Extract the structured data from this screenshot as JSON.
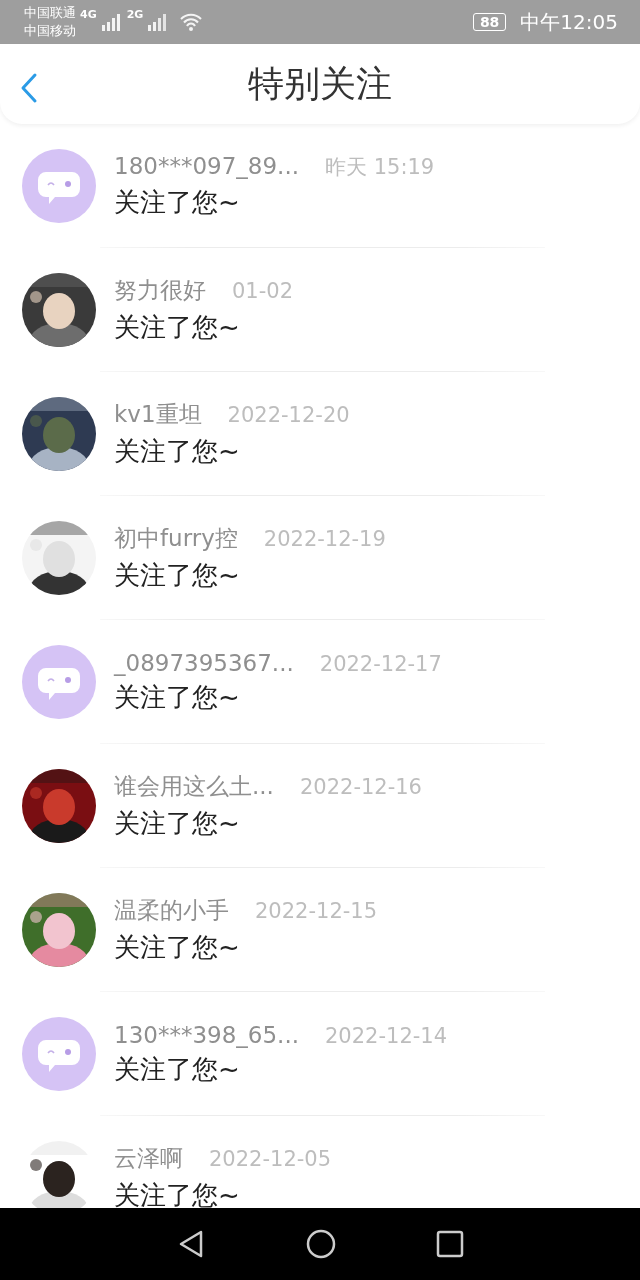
{
  "status_bar": {
    "carriers": [
      "中国联通",
      "中国移动"
    ],
    "network_1": "4G",
    "network_2": "2G",
    "battery": "88",
    "time": "中午12:05"
  },
  "header": {
    "title": "特别关注"
  },
  "notifications": [
    {
      "avatar": {
        "kind": "default"
      },
      "name": "180***097_89...",
      "time": "昨天 15:19",
      "message": "关注了您~"
    },
    {
      "name": "努力很好",
      "time": "01-02",
      "message": "关注了您~"
    },
    {
      "name": "kv1重坦",
      "time": "2022-12-20",
      "message": "关注了您~"
    },
    {
      "name": "初中furry控",
      "time": "2022-12-19",
      "message": "关注了您~"
    },
    {
      "avatar": {
        "kind": "default"
      },
      "name": "_0897395367...",
      "time": "2022-12-17",
      "message": "关注了您~"
    },
    {
      "name": "谁会用这么土...",
      "time": "2022-12-16",
      "message": "关注了您~"
    },
    {
      "name": "温柔的小手",
      "time": "2022-12-15",
      "message": "关注了您~"
    },
    {
      "avatar": {
        "kind": "default"
      },
      "name": "130***398_65...",
      "time": "2022-12-14",
      "message": "关注了您~"
    },
    {
      "name": "云泽啊",
      "time": "2022-12-05",
      "message": "关注了您~"
    }
  ]
}
